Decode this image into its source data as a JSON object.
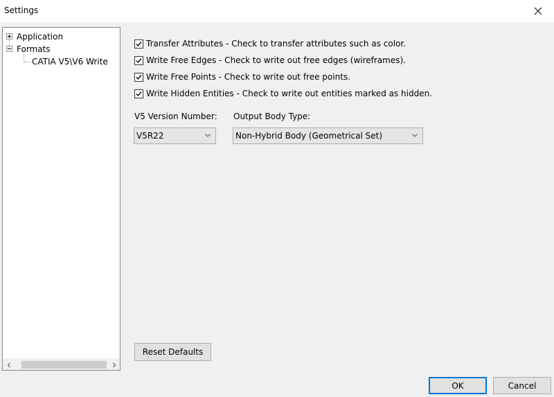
{
  "window": {
    "title": "Settings"
  },
  "tree": {
    "items": [
      {
        "label": "Application",
        "expander": "plus"
      },
      {
        "label": "Formats",
        "expander": "minus"
      },
      {
        "label": "CATIA V5\\V6 Write"
      }
    ]
  },
  "options": [
    {
      "label": "Transfer Attributes - Check to transfer attributes such as color.",
      "checked": true
    },
    {
      "label": "Write Free Edges - Check to write out free edges (wireframes).",
      "checked": true
    },
    {
      "label": "Write Free Points - Check to write out free points.",
      "checked": true
    },
    {
      "label": "Write Hidden Entities - Check to write out entities marked as hidden.",
      "checked": true
    }
  ],
  "version": {
    "label": "V5 Version Number:",
    "value": "V5R22"
  },
  "body_type": {
    "label": "Output Body Type:",
    "value": "Non-Hybrid Body (Geometrical Set)"
  },
  "buttons": {
    "reset": "Reset Defaults",
    "ok": "OK",
    "cancel": "Cancel"
  },
  "icons": {
    "close": "close-icon",
    "scroll_left": "chevron-left-icon",
    "scroll_right": "chevron-right-icon",
    "dropdown": "chevron-down-icon"
  },
  "colors": {
    "accent": "#0078d7",
    "window_bg": "#f0f0f0"
  }
}
